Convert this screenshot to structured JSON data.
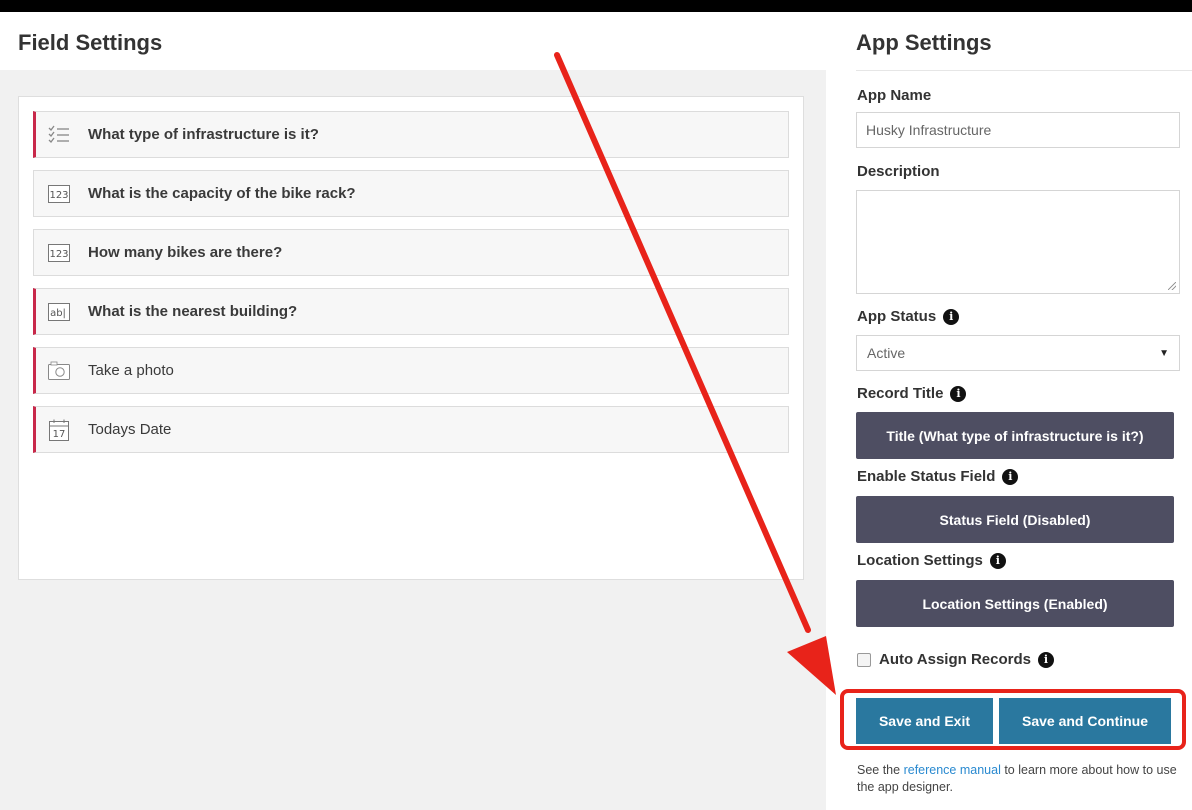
{
  "field_settings": {
    "title": "Field Settings",
    "fields": [
      {
        "label": "What type of infrastructure is it?",
        "icon": "checklist-icon",
        "required": true
      },
      {
        "label": "What is the capacity of the bike rack?",
        "icon": "number-icon",
        "icon_text": "123",
        "required": false
      },
      {
        "label": "How many bikes are there?",
        "icon": "number-icon",
        "icon_text": "123",
        "required": false
      },
      {
        "label": "What is the nearest building?",
        "icon": "text-field-icon",
        "icon_text": "ab|",
        "required": true
      },
      {
        "label": "Take a photo",
        "icon": "camera-icon",
        "required": true
      },
      {
        "label": "Todays Date",
        "icon": "calendar-icon",
        "icon_text": "17",
        "required": true
      }
    ]
  },
  "app_settings": {
    "title": "App Settings",
    "app_name_label": "App Name",
    "app_name_value": "Husky Infrastructure",
    "description_label": "Description",
    "description_value": "",
    "app_status_label": "App Status",
    "app_status_value": "Active",
    "record_title_label": "Record Title",
    "record_title_button": "Title (What type of infrastructure is it?)",
    "status_field_label": "Enable Status Field",
    "status_field_button": "Status Field (Disabled)",
    "location_label": "Location Settings",
    "location_button": "Location Settings (Enabled)",
    "auto_assign_label": "Auto Assign Records",
    "auto_assign_checked": false,
    "save_exit": "Save and Exit",
    "save_continue": "Save and Continue",
    "footnote_pre": "See the ",
    "footnote_link": "reference manual",
    "footnote_post": " to learn more about how to use the app designer."
  },
  "colors": {
    "accent_blue": "#2a789f",
    "dark_button": "#4e4e62",
    "required_marker": "#c8284a",
    "annotation_red": "#e8231a",
    "link": "#2a8ad0"
  }
}
